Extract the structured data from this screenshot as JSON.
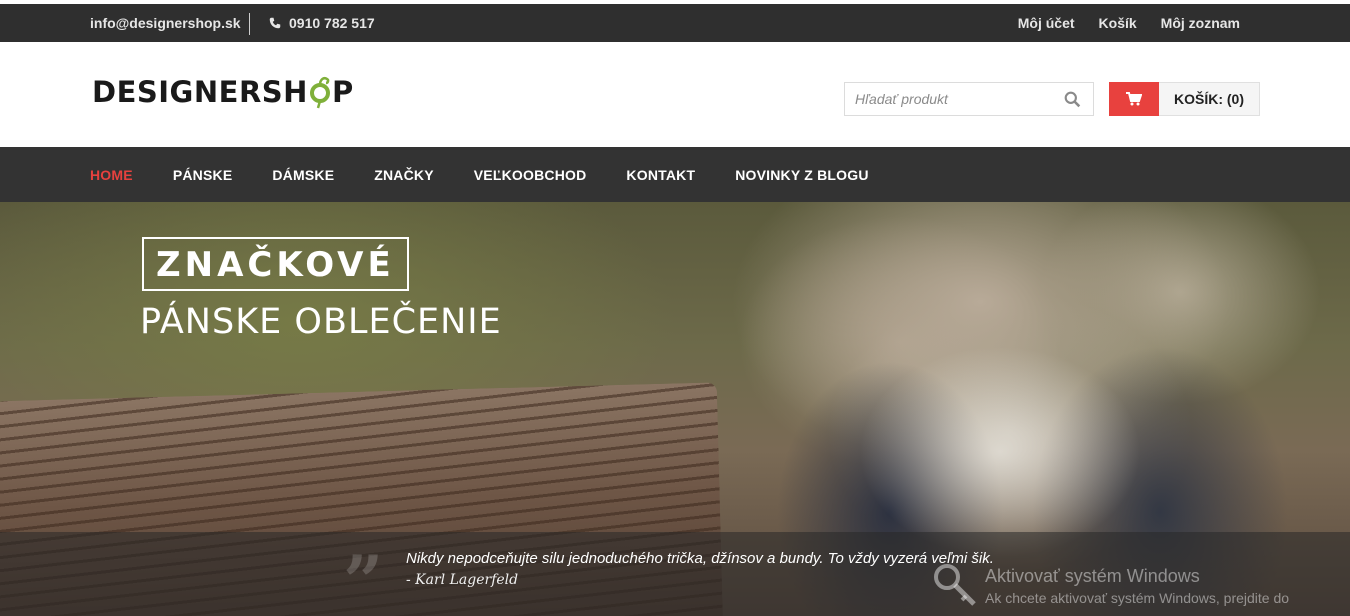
{
  "topbar": {
    "email": "info@designershop.sk",
    "phone": "0910 782 517",
    "links": [
      "Môj účet",
      "Košík",
      "Môj zoznam"
    ]
  },
  "header": {
    "logo_text_a": "DESIGNERSH",
    "logo_text_b": "P",
    "search_placeholder": "Hľadať produkt",
    "cart_label": "KOŠÍK: (0)"
  },
  "nav": {
    "items": [
      "HOME",
      "PÁNSKE",
      "DÁMSKE",
      "ZNAČKY",
      "VEĽKOOBCHOD",
      "KONTAKT",
      "NOVINKY Z BLOGU"
    ],
    "active_index": 0
  },
  "hero": {
    "badge": "ZNAČKOVÉ",
    "subtitle": "PÁNSKE OBLEČENIE",
    "quote": "Nikdy nepodceňujte silu jednoduchého trička, džínsov a bundy. To vždy vyzerá veľmi šik.",
    "author": "- Karl Lagerfeld"
  },
  "watermark": {
    "title": "Aktivovať systém Windows",
    "subtitle": "Ak chcete aktivovať systém Windows, prejdite do"
  },
  "colors": {
    "accent": "#e8413e",
    "topbar_bg": "#2f2f2f",
    "nav_bg": "#333333",
    "logo_green": "#7fb03a"
  }
}
